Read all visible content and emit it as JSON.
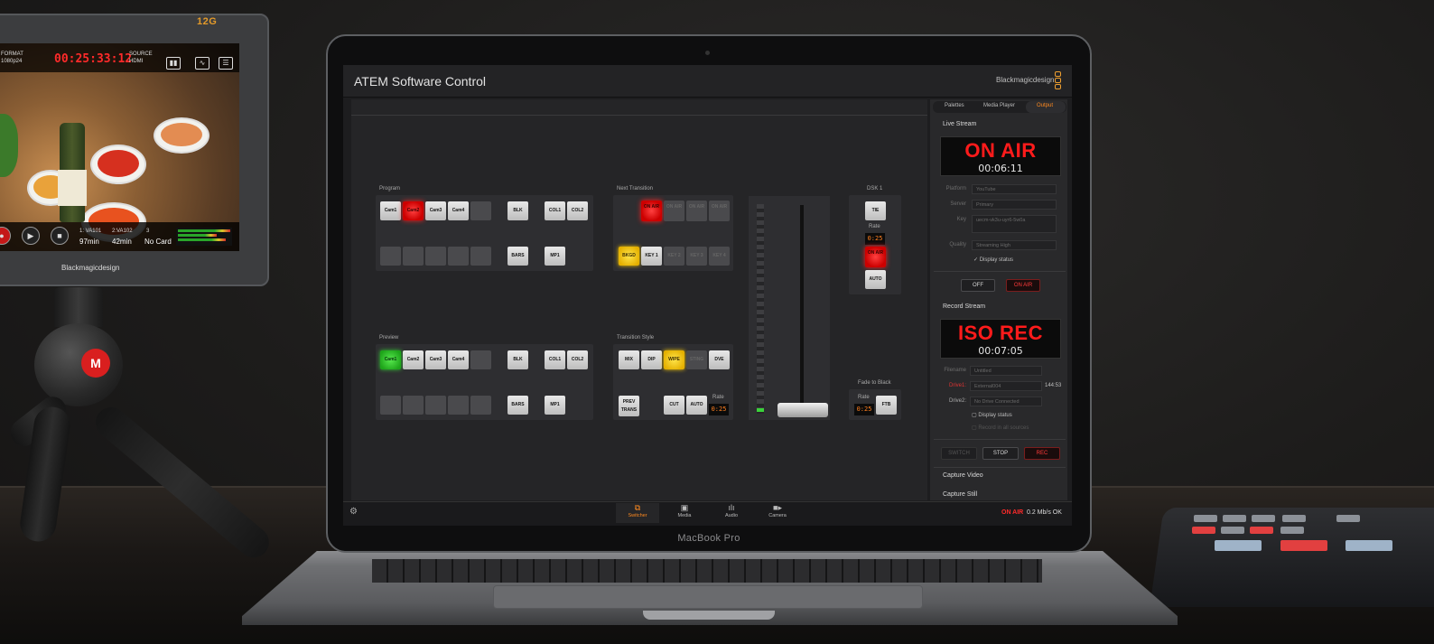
{
  "monitor": {
    "brand_top": "12G",
    "format_label": "FORMAT",
    "format_value": "1080p24",
    "timecode": "00:25:33:12",
    "source_label": "SOURCE",
    "source_value": "HDMI",
    "slot1_label": "1: VA101",
    "slot1_value": "97min",
    "slot2_label": "2:VA102",
    "slot2_value": "42min",
    "slot3_label": "3",
    "slot3_value": "No Card",
    "logo_text": "Blackmagicdesign",
    "colors": {
      "timecode": "#ff2a2a"
    }
  },
  "tripod": {
    "logo_glyph": "M"
  },
  "laptop": {
    "brand": "MacBook Pro"
  },
  "app": {
    "title": "ATEM Software Control",
    "logo_text": "Blackmagicdesign",
    "accent_color": "#ff8a1f",
    "program": {
      "label": "Program",
      "row1": [
        "Cam1",
        "Cam2",
        "Cam3",
        "Cam4",
        "",
        "BLK",
        "COL1",
        "COL2"
      ],
      "row2": [
        "",
        "",
        "",
        "",
        "",
        "BARS",
        "MP1"
      ],
      "active": "Cam2"
    },
    "preview": {
      "label": "Preview",
      "row1": [
        "Cam1",
        "Cam2",
        "Cam3",
        "Cam4",
        "",
        "BLK",
        "COL1",
        "COL2"
      ],
      "row2": [
        "",
        "",
        "",
        "",
        "",
        "BARS",
        "MP1"
      ],
      "active": "Cam1"
    },
    "next_transition": {
      "label": "Next Transition",
      "row1": [
        "ON AIR",
        "ON AIR",
        "ON AIR",
        "ON AIR"
      ],
      "row2": [
        "BKGD",
        "KEY 1",
        "KEY 2",
        "KEY 3",
        "KEY 4"
      ]
    },
    "transition_style": {
      "label": "Transition Style",
      "row1": [
        "MIX",
        "DIP",
        "WIPE",
        "STING",
        "DVE"
      ],
      "prev_trans": "PREV TRANS",
      "cut": "CUT",
      "auto": "AUTO",
      "rate_label": "Rate",
      "rate_value": "0:25"
    },
    "dsk": {
      "label": "DSK 1",
      "tie": "TIE",
      "rate_label": "Rate",
      "rate_value": "0:25",
      "on_air": "ON AIR",
      "auto": "AUTO"
    },
    "fade_to_black": {
      "label": "Fade to Black",
      "rate_label": "Rate",
      "rate_value": "0:25",
      "ftb": "FTB"
    },
    "right_panel": {
      "tabs": [
        "Palettes",
        "Media Player",
        "Output"
      ],
      "active_tab": "Output",
      "live_stream": {
        "title": "Live Stream",
        "status": "ON AIR",
        "time": "00:06:11",
        "platform_label": "Platform",
        "platform_value": "YouTube",
        "server_label": "Server",
        "server_value": "Primary",
        "key_label": "Key",
        "key_value": "uecm-vk3u-uyr6-5w0a",
        "quality_label": "Quality",
        "quality_value": "Streaming High",
        "display_status": "Display status",
        "off_button": "OFF",
        "on_air_button": "ON AIR"
      },
      "record_stream": {
        "title": "Record Stream",
        "status": "ISO REC",
        "time": "00:07:05",
        "filename_label": "Filename",
        "filename_value": "Untitled",
        "drive1_label": "Drive1:",
        "drive1_value": "External004",
        "drive1_time": "144:53",
        "drive2_label": "Drive2:",
        "drive2_value": "No Drive Connected",
        "display_status": "Display status",
        "record_all": "Record in all sources",
        "switch_button": "SWITCH",
        "stop_button": "STOP",
        "rec_button": "REC"
      },
      "capture_video": "Capture Video",
      "capture_still": "Capture Still"
    },
    "bottom_nav": [
      {
        "label": "Switcher",
        "glyph": "⧉",
        "active": true
      },
      {
        "label": "Media",
        "glyph": "▣",
        "active": false
      },
      {
        "label": "Audio",
        "glyph": "ılı",
        "active": false
      },
      {
        "label": "Camera",
        "glyph": "■▸",
        "active": false
      }
    ],
    "status": {
      "on_air": "ON AIR",
      "rate": "0.2 Mb/s OK"
    },
    "settings_glyph": "⚙"
  }
}
